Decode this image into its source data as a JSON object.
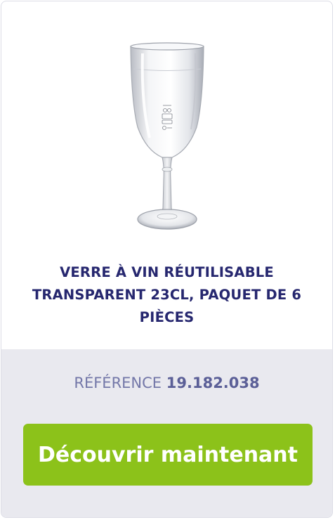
{
  "product": {
    "image_icon": "wine-glass",
    "title": "VERRE À VIN RÉUTILISABLE TRANSPARENT 23CL, PAQUET DE 6 PIÈCES"
  },
  "reference": {
    "label": "RÉFÉRENCE",
    "value": "19.182.038"
  },
  "cta": {
    "label": "Découvrir maintenant"
  },
  "colors": {
    "title": "#26276f",
    "reference_label": "#7377a8",
    "reference_value": "#5b5f97",
    "cta_background": "#8cc21a",
    "footer_background": "#e9e9ef"
  }
}
